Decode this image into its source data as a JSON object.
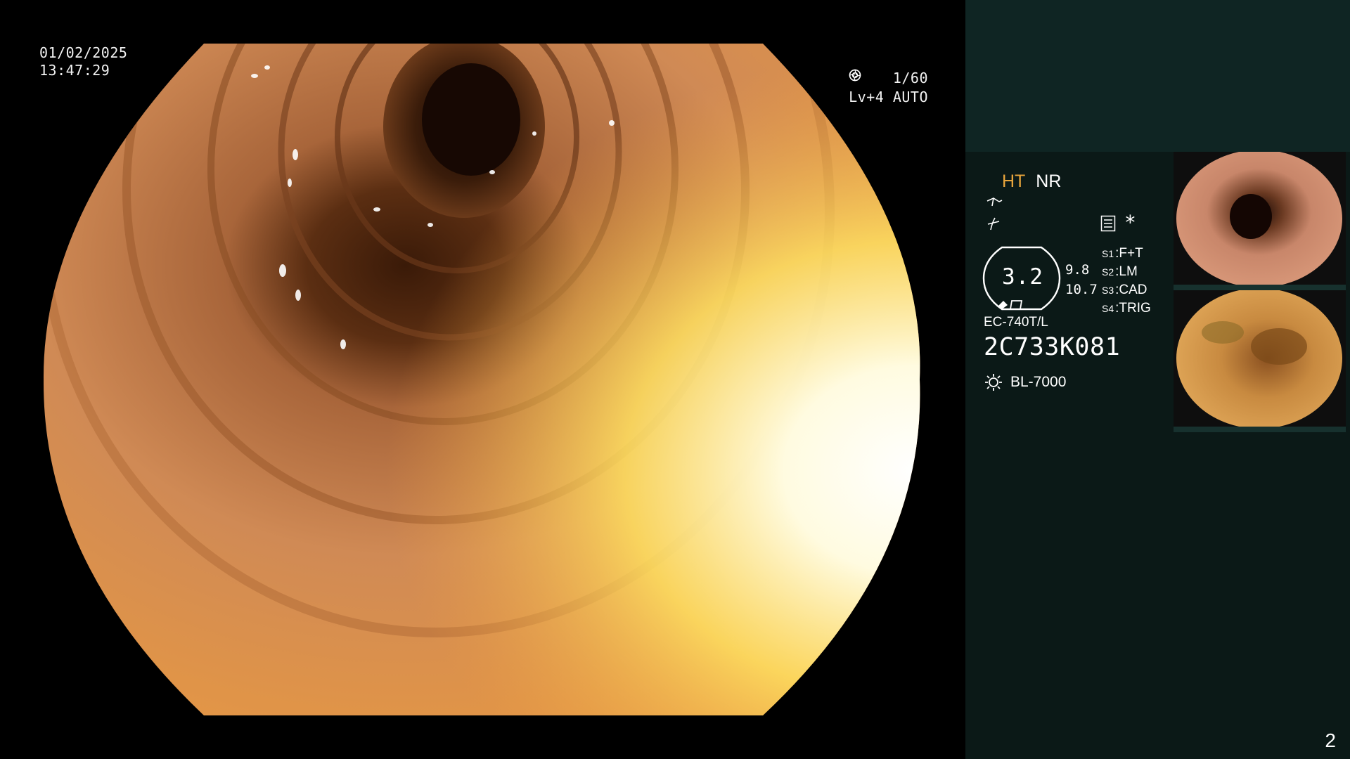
{
  "live": {
    "date": "01/02/2025",
    "time": "13:47:29",
    "shutter": "1/60",
    "level": "Lv+4 AUTO"
  },
  "panel": {
    "mode_ht": "HT",
    "mode_nr": "NR",
    "enhancement_value": "3.2",
    "side_value_1": "9.8",
    "side_value_2": "10.7",
    "menu_star": "*",
    "switches": [
      {
        "key": "S1",
        "value": "F+T"
      },
      {
        "key": "S2",
        "value": "LM"
      },
      {
        "key": "S3",
        "value": "CAD"
      },
      {
        "key": "S4",
        "value": "TRIG"
      }
    ],
    "scope_model": "EC-740T/L",
    "scope_serial": "2C733K081",
    "light_source": "BL-7000",
    "page_number": "2"
  },
  "icons": {
    "shutter": "aperture-icon",
    "auto": "iris-icon",
    "zoom": "zoom-icon",
    "sharpness": "sharpness-icon",
    "menu": "menu-list-icon",
    "scope": "scope-tip-icon",
    "light": "light-source-icon"
  },
  "colors": {
    "panel_bg": "#0b1917",
    "panel_top": "#0f2523",
    "ht_label": "#e8a53c",
    "tissue_main": "#d98a45",
    "tissue_bright": "#fff8c0"
  }
}
